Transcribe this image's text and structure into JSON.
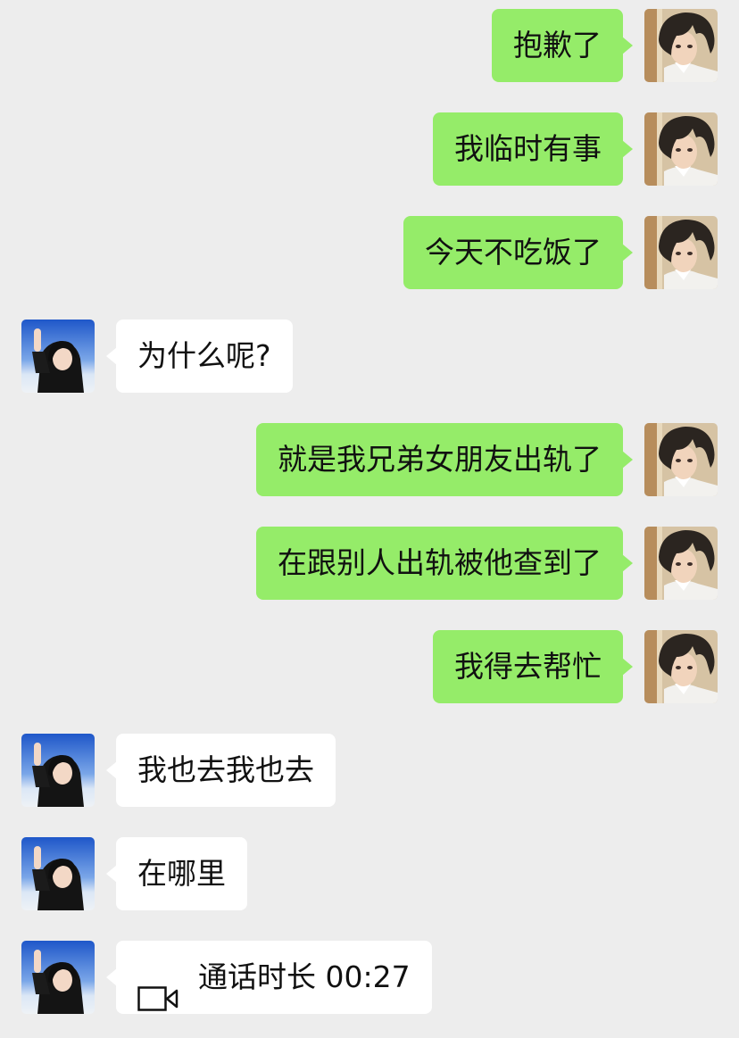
{
  "messages": [
    {
      "side": "out",
      "text": "抱歉了"
    },
    {
      "side": "out",
      "text": "我临时有事"
    },
    {
      "side": "out",
      "text": "今天不吃饭了"
    },
    {
      "side": "in",
      "text": "为什么呢?"
    },
    {
      "side": "out",
      "text": "就是我兄弟女朋友出轨了"
    },
    {
      "side": "out",
      "text": "在跟别人出轨被他查到了"
    },
    {
      "side": "out",
      "text": "我得去帮忙"
    },
    {
      "side": "in",
      "text": "我也去我也去"
    },
    {
      "side": "in",
      "text": "在哪里"
    },
    {
      "side": "in",
      "type": "video-call",
      "text": "通话时长 00:27",
      "icon": "video-camera-icon"
    }
  ],
  "colors": {
    "background": "#ededed",
    "outgoing_bubble": "#95ec69",
    "incoming_bubble": "#ffffff",
    "text": "#111111"
  }
}
